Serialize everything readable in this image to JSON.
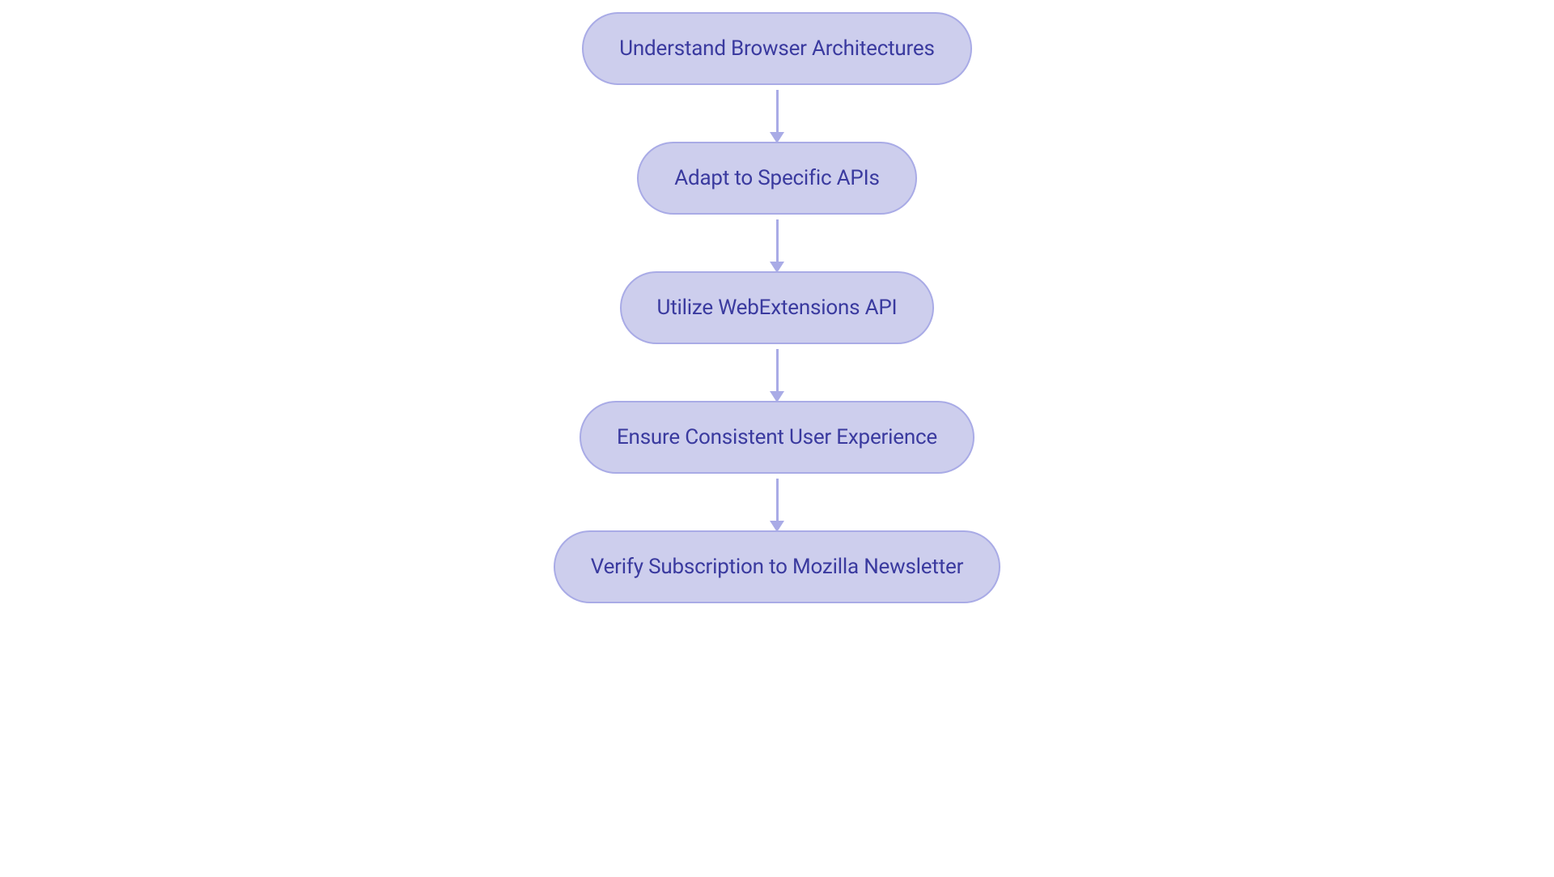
{
  "flowchart": {
    "nodes": [
      {
        "label": "Understand Browser Architectures"
      },
      {
        "label": "Adapt to Specific APIs"
      },
      {
        "label": "Utilize WebExtensions API"
      },
      {
        "label": "Ensure Consistent User Experience"
      },
      {
        "label": "Verify Subscription to Mozilla Newsletter"
      }
    ]
  },
  "chart_data": {
    "type": "flowchart",
    "direction": "vertical",
    "nodes": [
      "Understand Browser Architectures",
      "Adapt to Specific APIs",
      "Utilize WebExtensions API",
      "Ensure Consistent User Experience",
      "Verify Subscription to Mozilla Newsletter"
    ],
    "edges": [
      {
        "from": 0,
        "to": 1
      },
      {
        "from": 1,
        "to": 2
      },
      {
        "from": 2,
        "to": 3
      },
      {
        "from": 3,
        "to": 4
      }
    ]
  }
}
